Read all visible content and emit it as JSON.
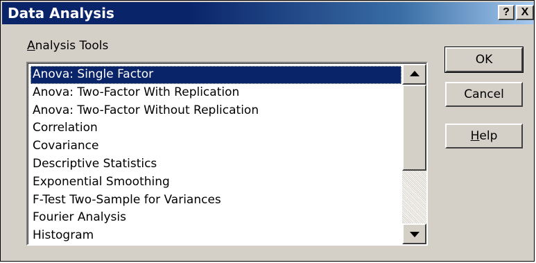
{
  "window": {
    "title": "Data Analysis",
    "help_button": "?",
    "close_button": "X"
  },
  "analysis_tools": {
    "label_accel": "A",
    "label_rest": "nalysis Tools",
    "items": [
      "Anova: Single Factor",
      "Anova: Two-Factor With Replication",
      "Anova: Two-Factor Without Replication",
      "Correlation",
      "Covariance",
      "Descriptive Statistics",
      "Exponential Smoothing",
      "F-Test Two-Sample for Variances",
      "Fourier Analysis",
      "Histogram"
    ],
    "selected_index": 0
  },
  "buttons": {
    "ok": "OK",
    "cancel": "Cancel",
    "help_accel": "H",
    "help_rest": "elp"
  },
  "colors": {
    "selection": "#0a246a",
    "face": "#d4d0c8"
  }
}
